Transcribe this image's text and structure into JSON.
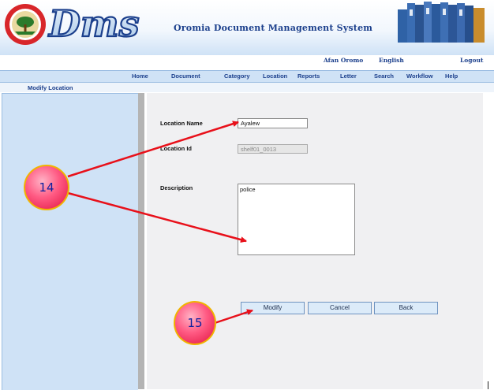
{
  "header": {
    "title": "Oromia Document Management System",
    "logo_text": "Dms"
  },
  "lang_links": [
    "Afan Oromo",
    "English",
    "Logout"
  ],
  "nav": {
    "items": [
      "Home",
      "Document",
      "Category",
      "Location",
      "Reports",
      "Letter",
      "Search",
      "Workflow",
      "Help"
    ]
  },
  "breadcrumb": "Modify Location",
  "form": {
    "location_name_label": "Location Name",
    "location_name_value": "Ayalew",
    "location_id_label": "Location Id",
    "location_id_value": "shelf01_0013",
    "description_label": "Description",
    "description_value": "police"
  },
  "buttons": {
    "modify": "Modify",
    "cancel": "Cancel",
    "back": "Back"
  },
  "annotations": {
    "callout_a": "14",
    "callout_b": "15"
  },
  "colors": {
    "brand_blue": "#1b3f8c",
    "nav_bg": "#cfe2f6",
    "arrow_red": "#e8101a"
  }
}
